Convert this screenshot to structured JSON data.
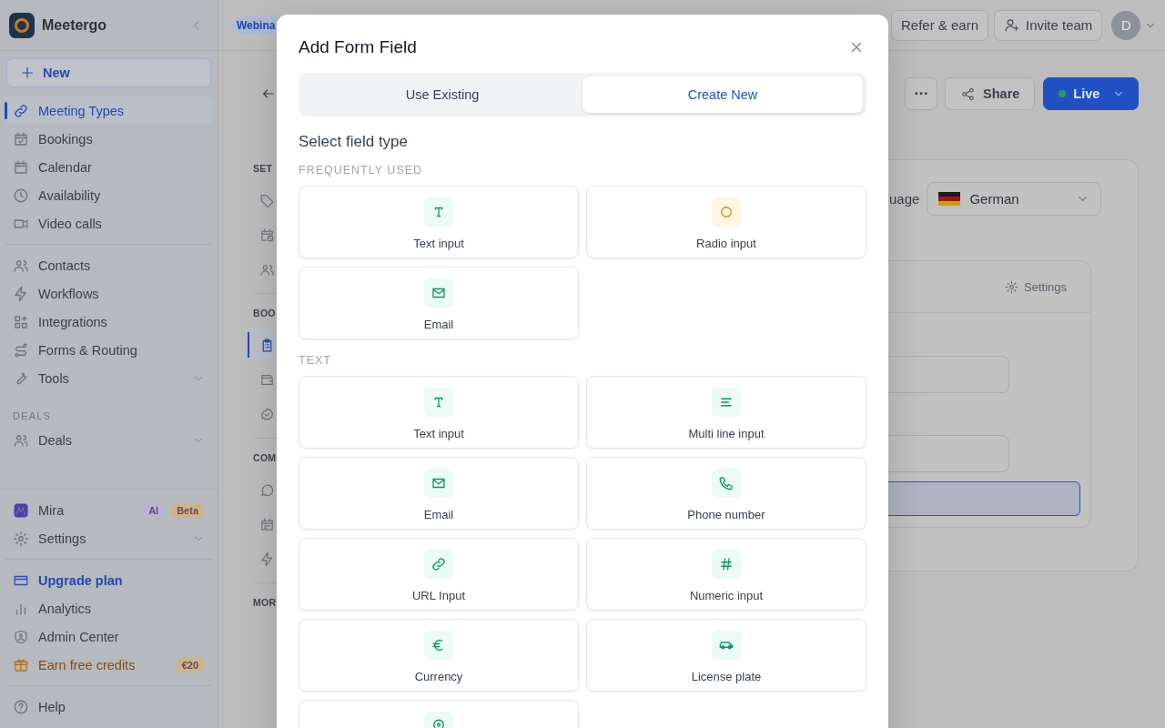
{
  "sidebar": {
    "brand": "Meetergo",
    "new_button": "New",
    "nav_groups": [
      {
        "items": [
          {
            "label": "Meeting Types",
            "selected": true,
            "kind": "plain"
          },
          {
            "label": "Bookings",
            "selected": false,
            "kind": "plain"
          },
          {
            "label": "Calendar",
            "selected": false,
            "kind": "plain"
          },
          {
            "label": "Availability",
            "selected": false,
            "kind": "plain"
          },
          {
            "label": "Video calls",
            "selected": false,
            "kind": "plain"
          }
        ]
      },
      {
        "items": [
          {
            "label": "Contacts",
            "selected": false,
            "kind": "plain"
          },
          {
            "label": "Workflows",
            "selected": false,
            "kind": "plain"
          },
          {
            "label": "Integrations",
            "selected": false,
            "kind": "plain"
          },
          {
            "label": "Forms & Routing",
            "selected": false,
            "kind": "plain"
          },
          {
            "label": "Tools",
            "selected": false,
            "kind": "menu"
          }
        ]
      },
      {
        "heading": "DEALS",
        "items": [
          {
            "label": "Deals",
            "selected": false,
            "kind": "menu"
          }
        ]
      }
    ],
    "bottom_groups": [
      {
        "items": [
          {
            "label": "Mira",
            "selected": false,
            "kind": "assistant",
            "badges": [
              {
                "text": "AI",
                "color": "#bcb2d8"
              },
              {
                "text": "Beta",
                "color": "#cbb489"
              }
            ]
          },
          {
            "label": "Settings",
            "selected": false,
            "kind": "menu"
          }
        ]
      },
      {
        "items": [
          {
            "label": "Upgrade plan",
            "selected": false,
            "kind": "upgrade"
          },
          {
            "label": "Analytics",
            "selected": false,
            "kind": "plain"
          },
          {
            "label": "Admin Center",
            "selected": false,
            "kind": "plain"
          },
          {
            "label": "Earn free credits",
            "selected": false,
            "kind": "reward",
            "badges": [
              {
                "text": "€20",
                "color": "#cbb489"
              }
            ]
          }
        ]
      },
      {
        "items": [
          {
            "label": "Help",
            "selected": false,
            "kind": "plain"
          }
        ]
      }
    ]
  },
  "top_bar": {
    "tag": "Webina",
    "buttons": [
      "Refer & earn",
      "Invite team"
    ],
    "avatar": "D"
  },
  "section_nav": [
    {
      "heading": "SET",
      "items": [
        {
          "selected": false
        },
        {
          "selected": false
        },
        {
          "selected": false
        }
      ]
    },
    {
      "heading": "BOO",
      "items": [
        {
          "selected": true
        },
        {
          "selected": false
        },
        {
          "selected": false
        }
      ]
    },
    {
      "heading": "COM",
      "items": [
        {
          "selected": false
        },
        {
          "selected": false
        },
        {
          "selected": false
        }
      ]
    },
    {
      "heading": "MOR"
    }
  ],
  "page_actions": {
    "share": "Share",
    "status": "Live"
  },
  "card": {
    "language_label": "uage",
    "language": "German",
    "settings_link": "Settings",
    "rows": [
      {
        "kind": "input"
      },
      {
        "kind": "input"
      },
      {
        "kind": "highlight"
      }
    ]
  },
  "modal": {
    "title": "Add Form Field",
    "tabs": [
      {
        "label": "Use Existing",
        "selected": false
      },
      {
        "label": "Create New",
        "selected": true
      }
    ],
    "heading": "Select field type",
    "sections": [
      {
        "heading": "FREQUENTLY USED",
        "fields": [
          {
            "kind": "text",
            "label": "Text input"
          },
          {
            "kind": "radio",
            "label": "Radio input"
          },
          {
            "kind": "email",
            "label": "Email"
          }
        ]
      },
      {
        "heading": "TEXT",
        "fields": [
          {
            "kind": "text",
            "label": "Text input"
          },
          {
            "kind": "multiline",
            "label": "Multi line input"
          },
          {
            "kind": "email",
            "label": "Email"
          },
          {
            "kind": "phone",
            "label": "Phone number"
          },
          {
            "kind": "url",
            "label": "URL Input"
          },
          {
            "kind": "numeric",
            "label": "Numeric input"
          },
          {
            "kind": "currency",
            "label": "Currency"
          },
          {
            "kind": "license",
            "label": "License plate"
          },
          {
            "kind": "location"
          }
        ]
      }
    ]
  }
}
